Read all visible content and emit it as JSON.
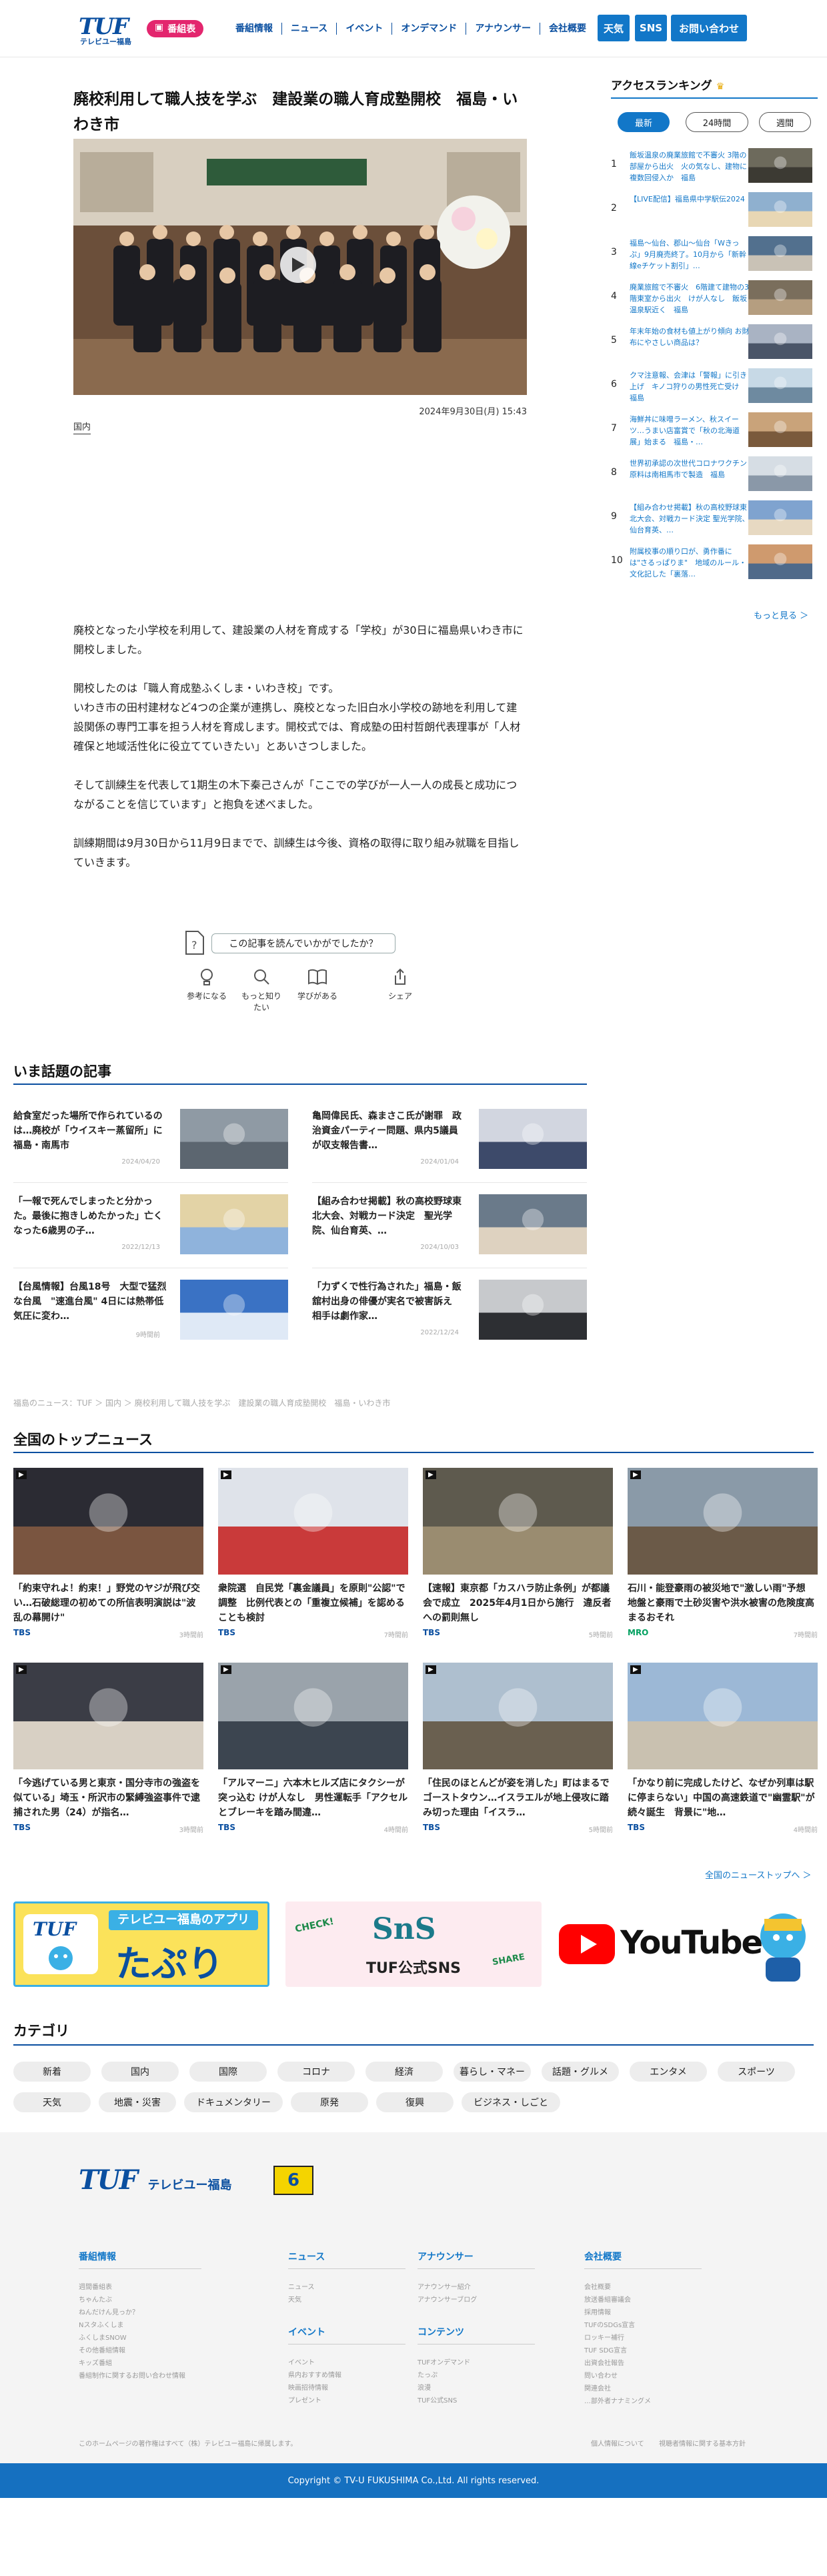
{
  "header": {
    "logo_main": "TUF",
    "logo_sub": "テレビユー福島",
    "tv_button": "番組表",
    "nav": [
      "番組情報",
      "ニュース",
      "イベント",
      "オンデマンド",
      "アナウンサー",
      "会社概要"
    ],
    "btn_weather": "天気",
    "btn_sns": "SNS",
    "btn_contact": "お問い合わせ"
  },
  "article": {
    "title": "廃校利用して職人技を学ぶ　建設業の職人育成塾開校　福島・いわき市",
    "date": "2024年9月30日(月) 15:43",
    "tag": "国内",
    "paragraphs": [
      "廃校となった小学校を利用して、建設業の人材を育成する「学校」が30日に福島県いわき市に開校しました。",
      "開校したのは「職人育成塾ふくしま・いわき校」です。",
      "いわき市の田村建材など4つの企業が連携し、廃校となった旧白水小学校の跡地を利用して建設関係の専門工事を担う人材を育成します。開校式では、育成塾の田村哲朗代表理事が「人材確保と地域活性化に役立てていきたい」とあいさつしました。",
      "そして訓練生を代表して1期生の木下秦己さんが「ここでの学びが一人一人の成長と成功につながることを信じています」と抱負を述べました。",
      "訓練期間は9月30日から11月9日までで、訓練生は今後、資格の取得に取り組み就職を目指していきます。"
    ],
    "feedback_prompt": "この記事を読んでいかがでしたか？",
    "reactions": [
      "参考になる",
      "もっと知りたい",
      "学びがある",
      "シェア"
    ]
  },
  "ranking": {
    "title": "アクセスランキング",
    "tabs": [
      "最新",
      "24時間",
      "週間"
    ],
    "items": [
      {
        "n": "1",
        "t": "飯坂温泉の廃業旅館で不審火 3階の部屋から出火　火の気なし、建物に複数回侵入か　福島"
      },
      {
        "n": "2",
        "t": "【LIVE配信】福島県中学駅伝2024"
      },
      {
        "n": "3",
        "t": "福島～仙台、郡山～仙台「Wきっぷ」9月廃売終了。10月から「新幹線eチケット割引」…"
      },
      {
        "n": "4",
        "t": "廃業旅館で不審火　6階建て建物の3階東室から出火　けが人なし　飯坂温泉駅近く　福島"
      },
      {
        "n": "5",
        "t": "年末年始の食材も値上がり傾向 お財布にやさしい商品は？"
      },
      {
        "n": "6",
        "t": "クマ注意報、会津は「警報」に引き上げ　キノコ狩りの男性死亡受け　福島"
      },
      {
        "n": "7",
        "t": "海鮮丼に味噌ラーメン、秋スイーツ…うまい店富賞で「秋の北海道展」始まる　福島・…"
      },
      {
        "n": "8",
        "t": "世界初承認の次世代コロナワクチン　原料は南相馬市で製造　福島"
      },
      {
        "n": "9",
        "t": "【組み合わせ掲載】秋の高校野球東北大会、対戦カード決定 聖光学院、仙台育英、…"
      },
      {
        "n": "10",
        "t": "附属校事の順り口が、勇作番に は\"さるっぱりま\"　地域のルール・文化記した「裏落…"
      }
    ],
    "more": "もっと見る ＞"
  },
  "topics": {
    "title": "いま話題の記事",
    "items": [
      {
        "t": "給食室だった場所で作られているのは…廃校が「ウイスキー蒸留所」に　福島・南馬市",
        "d": "2024/04/20"
      },
      {
        "t": "亀岡偉民氏、森まさこ氏が謝罪　政治資金パーティー問題、県内5議員が収支報告書…",
        "d": "2024/01/04"
      },
      {
        "t": "「一報で死んでしまったと分かった。最後に抱きしめたかった」亡くなった6歳男の子…",
        "d": "2022/12/13"
      },
      {
        "t": "【組み合わせ掲載】秋の高校野球東北大会、対戦カード決定　聖光学院、仙台育英、…",
        "d": "2024/10/03"
      },
      {
        "t": "【台風情報】台風18号　大型で猛烈な台風　\"速進台風\" 4日には熱帯低気圧に変わ…",
        "d": "9時間前"
      },
      {
        "t": "「力ずくで性行為された」福島・飯舘村出身の俳優が実名で被害訴え　相手は劇作家…",
        "d": "2022/12/24"
      }
    ]
  },
  "breadcrumb": "福島のニュース：TUF ＞ 国内 ＞ 廃校利用して職人技を学ぶ　建設業の職人育成塾開校　福島・いわき市",
  "national": {
    "title": "全国のトップニュース",
    "items": [
      {
        "t": "「約束守れよ！約束！」野党のヤジが飛び交い…石破総理の初めての所信表明演説は\"波乱の幕開け\"",
        "s": "TBS",
        "h": "3時間前"
      },
      {
        "t": "衆院選　自民党「裏金議員」を原則\"公認\"で調整　比例代表との「重複立候補」を認めることも検討",
        "s": "TBS",
        "h": "7時間前"
      },
      {
        "t": "【速報】東京都「カスハラ防止条例」が都議会で成立　2025年4月1日から施行　違反者への罰則無し",
        "s": "TBS",
        "h": "5時間前"
      },
      {
        "t": "石川・能登豪雨の被災地で\"激しい雨\"予想　地盤と豪雨で土砂災害や洪水被害の危険度高まるおそれ",
        "s": "MRO",
        "h": "7時間前"
      },
      {
        "t": "「今逃げている男と東京・国分寺市の強盗を似ている」埼玉・所沢市の緊縛強盗事件で逮捕された男（24）が指名…",
        "s": "TBS",
        "h": "3時間前"
      },
      {
        "t": "「アルマーニ」六本木ヒルズ店にタクシーが突っ込む けが人なし　男性運転手「アクセルとブレーキを踏み間違…",
        "s": "TBS",
        "h": "4時間前"
      },
      {
        "t": "「住民のほとんどが姿を消した」町はまるでゴーストタウン…イスラエルが地上侵攻に踏み切った理由「イスラ…",
        "s": "TBS",
        "h": "5時間前"
      },
      {
        "t": "「かなり前に完成したけど、なぜか列車は駅に停まらない」中国の高速鉄道で\"幽霊駅\"が続々誕生　背景に\"地…",
        "s": "TBS",
        "h": "4時間前"
      }
    ],
    "more": "全国のニューストップへ ＞"
  },
  "banners": {
    "app_title": "テレビユー福島のアプリ",
    "app_name": "たぷり",
    "app_logo": "TUF",
    "sns_text": "TUF公式SNS",
    "sns_check": "CHECK!",
    "sns_share": "SHARE",
    "yt": "YouTube"
  },
  "categories": {
    "title": "カテゴリ",
    "row1": [
      "新着",
      "国内",
      "国際",
      "コロナ",
      "経済",
      "暮らし・マネー",
      "話題・グルメ",
      "エンタメ",
      "スポーツ"
    ],
    "row2": [
      "天気",
      "地震・災害",
      "ドキュメンタリー",
      "原発",
      "復興",
      "ビジネス・しごと"
    ]
  },
  "footer": {
    "logo_main": "TUF",
    "logo_sub": "テレビユー福島",
    "badge": "6",
    "col1": {
      "h": "番組情報",
      "links": [
        "週間番組表",
        "ちゃんたぶ",
        "ねんだけん見っか？",
        "Nスタふくしま",
        "ふくしまSNOW",
        "その他番組情報",
        "キッズ番組",
        "番組制作に関するお問い合わせ情報"
      ]
    },
    "col2a": {
      "h": "ニュース",
      "links": [
        "ニュース",
        "天気"
      ]
    },
    "col2b": {
      "h": "イベント",
      "links": [
        "イベント",
        "県内おすすめ情報",
        "映画招待情報",
        "プレゼント"
      ]
    },
    "col3a": {
      "h": "アナウンサー",
      "links": [
        "アナウンサー紹介",
        "アナウンサーブログ"
      ]
    },
    "col3b": {
      "h": "コンテンツ",
      "links": [
        "TUFオンデマンド",
        "たっぷ",
        "浪漫",
        "TUF公式SNS"
      ]
    },
    "col4": {
      "h": "会社概要",
      "links": [
        "会社概要",
        "放送番組審議会",
        "採用情報",
        "TUFのSDGs宣言",
        "ロッキー補行",
        "TUF SDG宣言",
        "出資会社報告",
        "問い合わせ",
        "関連会社",
        "…部外者ナナミングメ"
      ]
    },
    "note": "このホームページの著作権はすべて（株）テレビユー福島に帰属します。",
    "privacy": "個人情報について",
    "viewer": "視聴者情報に関する基本方針",
    "copyright": "Copyright © TV-U FUKUSHIMA Co.,Ltd. All rights reserved."
  },
  "colors": {
    "brand": "#0a4fa0",
    "accent": "#1277c8",
    "pink": "#e3266e"
  }
}
